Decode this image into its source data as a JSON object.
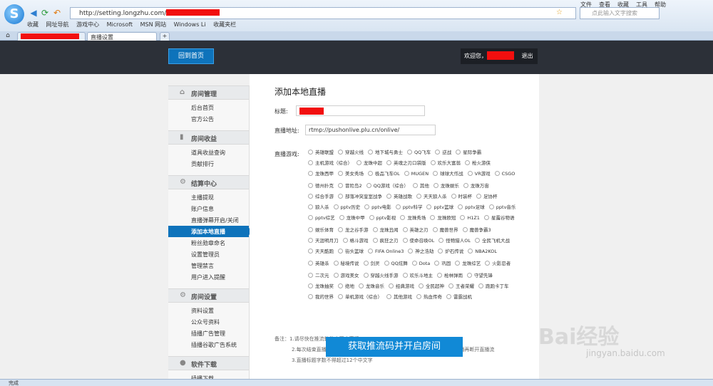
{
  "browser": {
    "url": "http://setting.longzhu.com/",
    "search_placeholder": "点此输入文字搜索",
    "menu": [
      "文件",
      "查看",
      "收藏",
      "工具",
      "帮助"
    ],
    "bookmarks": [
      "收藏",
      "网址导航",
      "游戏中心",
      "Microsoft",
      "MSN 网站",
      "Windows Li",
      "收藏夹栏"
    ],
    "tab_active": "直播设置",
    "tab_add": "+",
    "status": "完成"
  },
  "header": {
    "home_button": "回到首页",
    "welcome": "欢迎您，",
    "logout": "退出"
  },
  "sidebar": [
    {
      "title": "房间管理",
      "icon": "⌂",
      "items": [
        "后台首页",
        "官方公告"
      ]
    },
    {
      "title": "房间收益",
      "icon": "▮",
      "items": [
        "道具收益查询",
        "贡献排行"
      ]
    },
    {
      "title": "结算中心",
      "icon": "⚙",
      "items": [
        "主播提现",
        "账户信息",
        "直播弹幕开启/关闭",
        "添加本地直播",
        "粉丝勋章命名",
        "设置管理员",
        "管理禁言",
        "用户进入提醒"
      ]
    },
    {
      "title": "房间设置",
      "icon": "⚙",
      "items": [
        "资料设置",
        "公众号资料",
        "插播广告管理",
        "插播谷歌广告系统"
      ]
    },
    {
      "title": "软件下载",
      "icon": "●",
      "items": [
        "插播下载"
      ]
    }
  ],
  "form": {
    "heading": "添加本地直播",
    "title_label": "标题:",
    "address_label": "直播地址:",
    "address_value": "rtmp://pushonlive.plu.cn/onlive/",
    "game_label": "直播游戏:",
    "games": [
      "英雄联盟",
      "穿越火线",
      "地下城与勇士",
      "QQ飞车",
      "逆战",
      "星际争霸",
      "主机游戏（综合）",
      "龙珠中超",
      "英魂之刃口袋版",
      "欢乐大富翁",
      "枪火游侠",
      "龙珠西甲",
      "美女秀场",
      "极品飞车OL",
      "MUGEN",
      "球球大作战",
      "VR游戏",
      "CSGO",
      "德州扑克",
      "冒险岛2",
      "QQ游戏（综合）",
      "其他",
      "龙珠娱乐",
      "龙珠万宙",
      "综合手游",
      "部落冲突皇室战争",
      "英雄战歌",
      "天天狼人杀",
      "时装杯",
      "足协杯",
      "狼人杀",
      "pptv历史",
      "pptv电影",
      "pptv科学",
      "pptv篮球",
      "pptv足球",
      "pptv音乐",
      "pptv综艺",
      "龙珠中甲",
      "pptv影视",
      "龙珠秀场",
      "龙珠欧冠",
      "H1Z1",
      "星露谷物语",
      "娱乐体育",
      "龙之谷手游",
      "龙珠丑闻",
      "英雄之刃",
      "魔兽世界",
      "魔兽争霸3",
      "天涯明月刀",
      "格斗游戏",
      "疯狂之刃",
      "使命召唤OL",
      "怪物猎人OL",
      "全民飞机大战",
      "天天酷跑",
      "街头篮球",
      "FIFA Online3",
      "神之浩劫",
      "炉石传说",
      "NBA2KOL",
      "英雄杀",
      "秘境传说",
      "剑灵",
      "QQ炫舞",
      "Dota",
      "巩固",
      "龙珠综艺",
      "火影忍者",
      "二次元",
      "游戏美女",
      "穿越火线手游",
      "欢乐斗地主",
      "枪林弹雨",
      "守望先锋",
      "龙珠抽奖",
      "绝地",
      "龙珠音乐",
      "经典游戏",
      "全民超神",
      "王者荣耀",
      "跑跑卡丁车",
      "我的世界",
      "单机游戏（综合）",
      "其他游戏",
      "热血传奇",
      "雷霆战机"
    ],
    "notes": [
      "备注：1.请尽快在推流软件中开启直播",
      "2.每次结束直播时要手动点击以下的 “结束直播” 来关闭直播，建议先关闭直播再断开直播流",
      "3.直播标题字数不得超过12个中文字"
    ],
    "submit": "获取推流码并开启房间"
  },
  "watermark": {
    "brand": "Bai经验",
    "url": "jingyan.baidu.com"
  },
  "colors": {
    "accent": "#0e73bb",
    "header": "#2c3038",
    "redaction": "#f20f0f"
  }
}
